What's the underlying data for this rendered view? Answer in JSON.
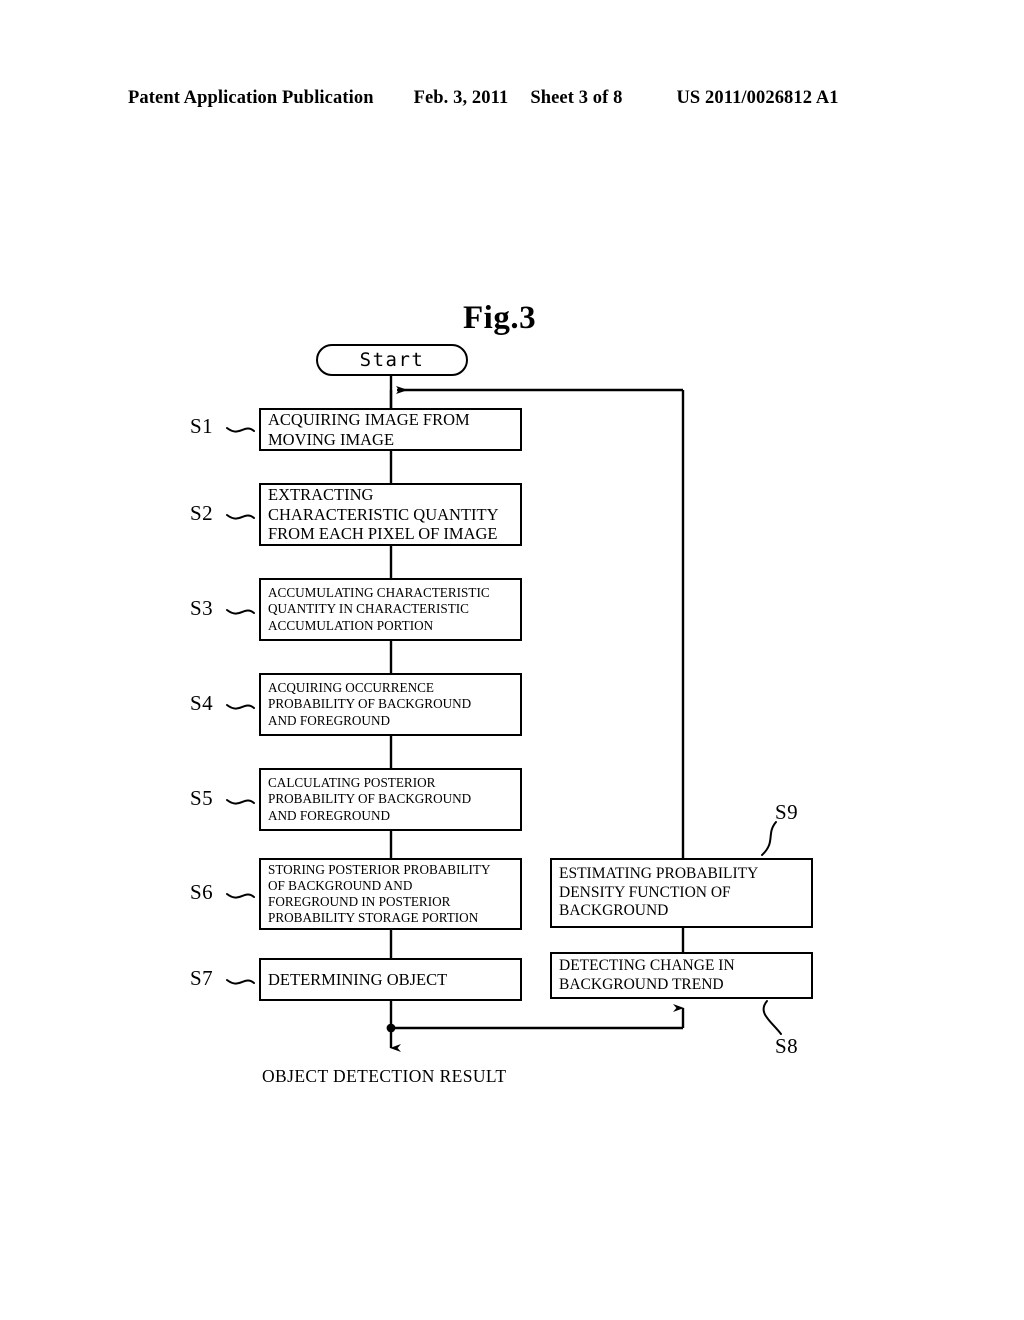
{
  "header": {
    "publication": "Patent Application Publication",
    "date": "Feb. 3, 2011",
    "sheet": "Sheet 3 of 8",
    "patent_number": "US 2011/0026812 A1"
  },
  "figure": {
    "title": "Fig.3",
    "caption": "OBJECT DETECTION RESULT"
  },
  "flowchart": {
    "start": {
      "label": "Start"
    },
    "steps": [
      {
        "id": "S1",
        "tag": "S1",
        "lines": [
          "ACQUIRING IMAGE FROM",
          "MOVING IMAGE"
        ]
      },
      {
        "id": "S2",
        "tag": "S2",
        "lines": [
          "EXTRACTING",
          "CHARACTERISTIC QUANTITY",
          "FROM EACH PIXEL OF IMAGE"
        ]
      },
      {
        "id": "S3",
        "tag": "S3",
        "lines": [
          "ACCUMULATING CHARACTERISTIC",
          "QUANTITY IN CHARACTERISTIC",
          "ACCUMULATION PORTION"
        ]
      },
      {
        "id": "S4",
        "tag": "S4",
        "lines": [
          "ACQUIRING OCCURRENCE",
          "PROBABILITY OF BACKGROUND",
          "AND FOREGROUND"
        ]
      },
      {
        "id": "S5",
        "tag": "S5",
        "lines": [
          "CALCULATING POSTERIOR",
          "PROBABILITY OF BACKGROUND",
          "AND FOREGROUND"
        ]
      },
      {
        "id": "S6",
        "tag": "S6",
        "lines": [
          "STORING POSTERIOR PROBABILITY",
          "OF BACKGROUND AND",
          "FOREGROUND IN POSTERIOR",
          "PROBABILITY STORAGE PORTION"
        ]
      },
      {
        "id": "S7",
        "tag": "S7",
        "lines": [
          "DETERMINING OBJECT"
        ]
      },
      {
        "id": "S9",
        "tag": "S9",
        "lines": [
          "ESTIMATING PROBABILITY",
          "DENSITY FUNCTION OF",
          "BACKGROUND"
        ]
      },
      {
        "id": "S8",
        "tag": "S8",
        "lines": [
          "DETECTING CHANGE IN",
          "BACKGROUND TREND"
        ]
      }
    ]
  },
  "colors": {
    "ink": "#000000",
    "paper": "#ffffff"
  }
}
